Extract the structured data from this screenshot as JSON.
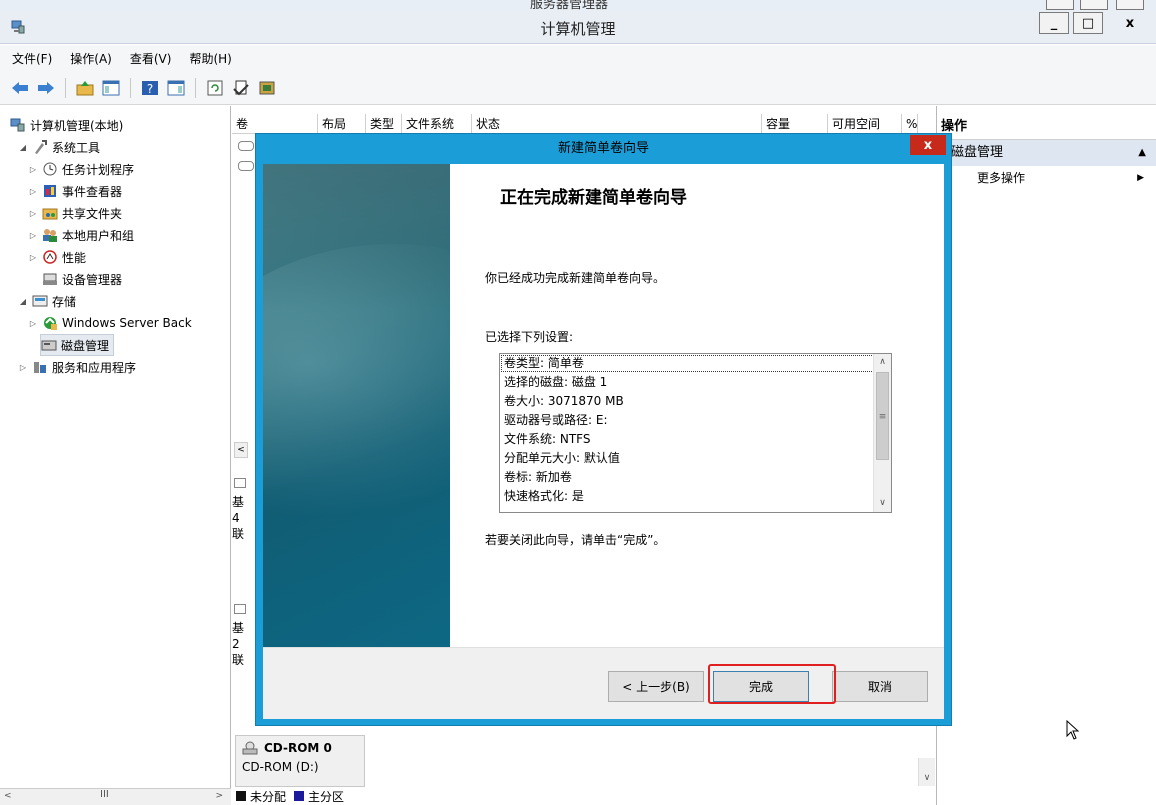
{
  "back_window": {
    "title": "服务器管理器"
  },
  "window": {
    "title": "计算机管理",
    "min": "_",
    "max": "□",
    "close": "x"
  },
  "menu": [
    "文件(F)",
    "操作(A)",
    "查看(V)",
    "帮助(H)"
  ],
  "tree": {
    "root": "计算机管理(本地)",
    "system_tools": "系统工具",
    "task_scheduler": "任务计划程序",
    "event_viewer": "事件查看器",
    "shared_folders": "共享文件夹",
    "local_users": "本地用户和组",
    "performance": "性能",
    "device_manager": "设备管理器",
    "storage": "存储",
    "wsb": "Windows Server Back",
    "disk_mgmt": "磁盘管理",
    "services_apps": "服务和应用程序"
  },
  "columns": [
    "卷",
    "布局",
    "类型",
    "文件系统",
    "状态",
    "容量",
    "可用空间",
    "%"
  ],
  "center_fragments": {
    "a": "基",
    "b": "4",
    "c": "联",
    "d": "基",
    "e": "2",
    "f": "联"
  },
  "cdrom": {
    "name": "CD-ROM 0",
    "type": "CD-ROM (D:)"
  },
  "legend": {
    "unallocated": "未分配",
    "primary": "主分区"
  },
  "actions": {
    "header": "操作",
    "section": "磁盘管理",
    "more": "更多操作"
  },
  "dialog": {
    "title": "新建简单卷向导",
    "heading": "正在完成新建简单卷向导",
    "success_text": "你已经成功完成新建简单卷向导。",
    "settings_label": "已选择下列设置:",
    "settings": [
      "卷类型: 简单卷",
      "选择的磁盘: 磁盘 1",
      "卷大小: 3071870 MB",
      "驱动器号或路径: E:",
      "文件系统: NTFS",
      "分配单元大小: 默认值",
      "卷标: 新加卷",
      "快速格式化: 是"
    ],
    "close_hint": "若要关闭此向导，请单击“完成”。",
    "back_button": "< 上一步(B)",
    "finish_button": "完成",
    "cancel_button": "取消",
    "close_x": "x"
  },
  "colors": {
    "dialog_border": "#1b9ed8",
    "highlight": "#e02020",
    "close_red": "#c7291b"
  }
}
